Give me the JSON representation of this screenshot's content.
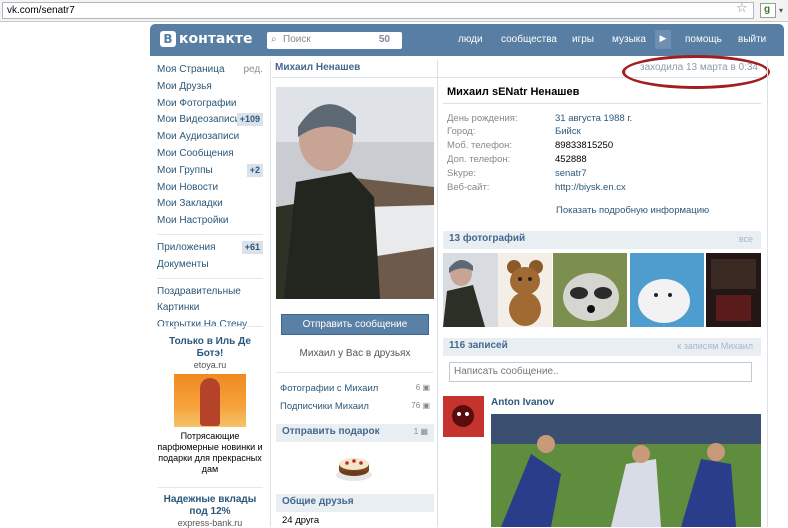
{
  "browser": {
    "url": "vk.com/senatr7"
  },
  "header": {
    "logo_text": "контакте",
    "logo_letter": "В",
    "search_placeholder": "Поиск",
    "search_count": "50",
    "nav": [
      "люди",
      "сообщества",
      "игры",
      "музыка",
      "помощь",
      "выйти"
    ]
  },
  "sidebar": {
    "items": [
      {
        "label": "Моя Страница",
        "extra": "ред."
      },
      {
        "label": "Мои Друзья"
      },
      {
        "label": "Мои Фотографии"
      },
      {
        "label": "Мои Видеозаписи",
        "badge": "+109"
      },
      {
        "label": "Мои Аудиозаписи"
      },
      {
        "label": "Мои Сообщения"
      },
      {
        "label": "Мои Группы",
        "badge": "+2"
      },
      {
        "label": "Мои Новости"
      },
      {
        "label": "Мои Закладки"
      },
      {
        "label": "Мои Настройки"
      }
    ],
    "items2": [
      {
        "label": "Приложения",
        "badge": "+61"
      },
      {
        "label": "Документы"
      }
    ],
    "items3": [
      {
        "label": "Поздравительные"
      },
      {
        "label": "Картинки"
      },
      {
        "label": "Открытки На Стену"
      }
    ],
    "ad1": {
      "title": "Только в Иль Де Ботэ!",
      "site": "etoya.ru",
      "desc": "Потрясающие парфюмерные новинки и подарки для прекрасных дам"
    },
    "ad2": {
      "title": "Надежные вклады под 12%",
      "site": "express-bank.ru"
    }
  },
  "profile": {
    "header_name": "Михаил Ненашев",
    "last_seen": "заходила 13 марта в 0:34",
    "full_name": "Михаил sENatr Ненашев",
    "send_message": "Отправить сообщение",
    "friend_note": "Михаил у Вас в друзьях",
    "links": [
      {
        "label": "Фотографии с Михаил",
        "count": "6"
      },
      {
        "label": "Подписчики Михаил",
        "count": "76"
      }
    ],
    "gift_box": {
      "title": "Отправить подарок",
      "count": "1"
    },
    "mutual": {
      "title": "Общие друзья",
      "count": "24 друга"
    },
    "info": [
      {
        "label": "День рождения:",
        "value": "31 августа 1988 г.",
        "link": true
      },
      {
        "label": "Город:",
        "value": "Бийск",
        "link": true
      },
      {
        "label": "Моб. телефон:",
        "value": "89833815250",
        "link": false
      },
      {
        "label": "Доп. телефон:",
        "value": "452888",
        "link": false
      },
      {
        "label": "Skype:",
        "value": "senatr7",
        "link": true
      },
      {
        "label": "Веб-сайт:",
        "value": "http://biysk.en.cx",
        "link": true
      }
    ],
    "show_more": "Показать подробную информацию",
    "photos": {
      "title": "13 фотографий",
      "all": "все"
    },
    "wall": {
      "title": "116 записей",
      "link": "к записям Михаил",
      "placeholder": "Написать сообщение.."
    },
    "post": {
      "author": "Anton Ivanov"
    }
  },
  "colors": {
    "header": "#587ea3",
    "link": "#2b587a",
    "accent_oval": "#a11f1f"
  }
}
